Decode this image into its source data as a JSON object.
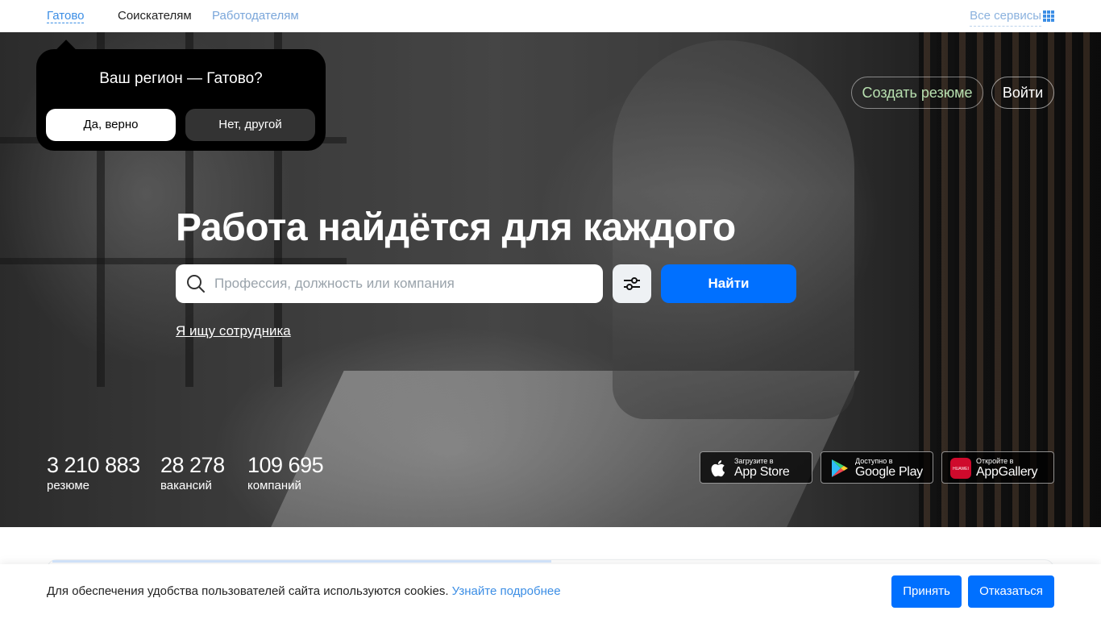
{
  "topbar": {
    "region": "Гатово",
    "nav_seekers": "Соискателям",
    "nav_employers": "Работодателям",
    "all_services": "Все сервисы"
  },
  "region_popup": {
    "question": "Ваш регион — Гатово?",
    "yes_label": "Да, верно",
    "no_label": "Нет, другой"
  },
  "hero": {
    "create_resume": "Создать резюме",
    "login": "Войти",
    "headline": "Работа найдётся для каждого",
    "search_placeholder": "Профессия, должность или компания",
    "search_value": "",
    "find_button": "Найти",
    "employer_link": "Я ищу сотрудника"
  },
  "stats": [
    {
      "number": "3 210 883",
      "label": "резюме"
    },
    {
      "number": "28 278",
      "label": "вакансий"
    },
    {
      "number": "109 695",
      "label": "компаний"
    }
  ],
  "stores": [
    {
      "small": "Загрузите в",
      "big": "App Store",
      "icon": "apple-icon"
    },
    {
      "small": "Доступно в",
      "big": "Google Play",
      "icon": "google-play-icon"
    },
    {
      "small": "Откройте в",
      "big": "AppGallery",
      "icon": "huawei-icon",
      "icon_text": "HUAWEI"
    }
  ],
  "cookie": {
    "text": "Для обеспечения удобства пользователей сайта используются cookies.",
    "more": "Узнайте подробнее",
    "accept": "Принять",
    "decline": "Отказаться"
  },
  "colors": {
    "accent": "#0070ff",
    "link": "#3c8ee5",
    "popup_bg": "#000000"
  }
}
